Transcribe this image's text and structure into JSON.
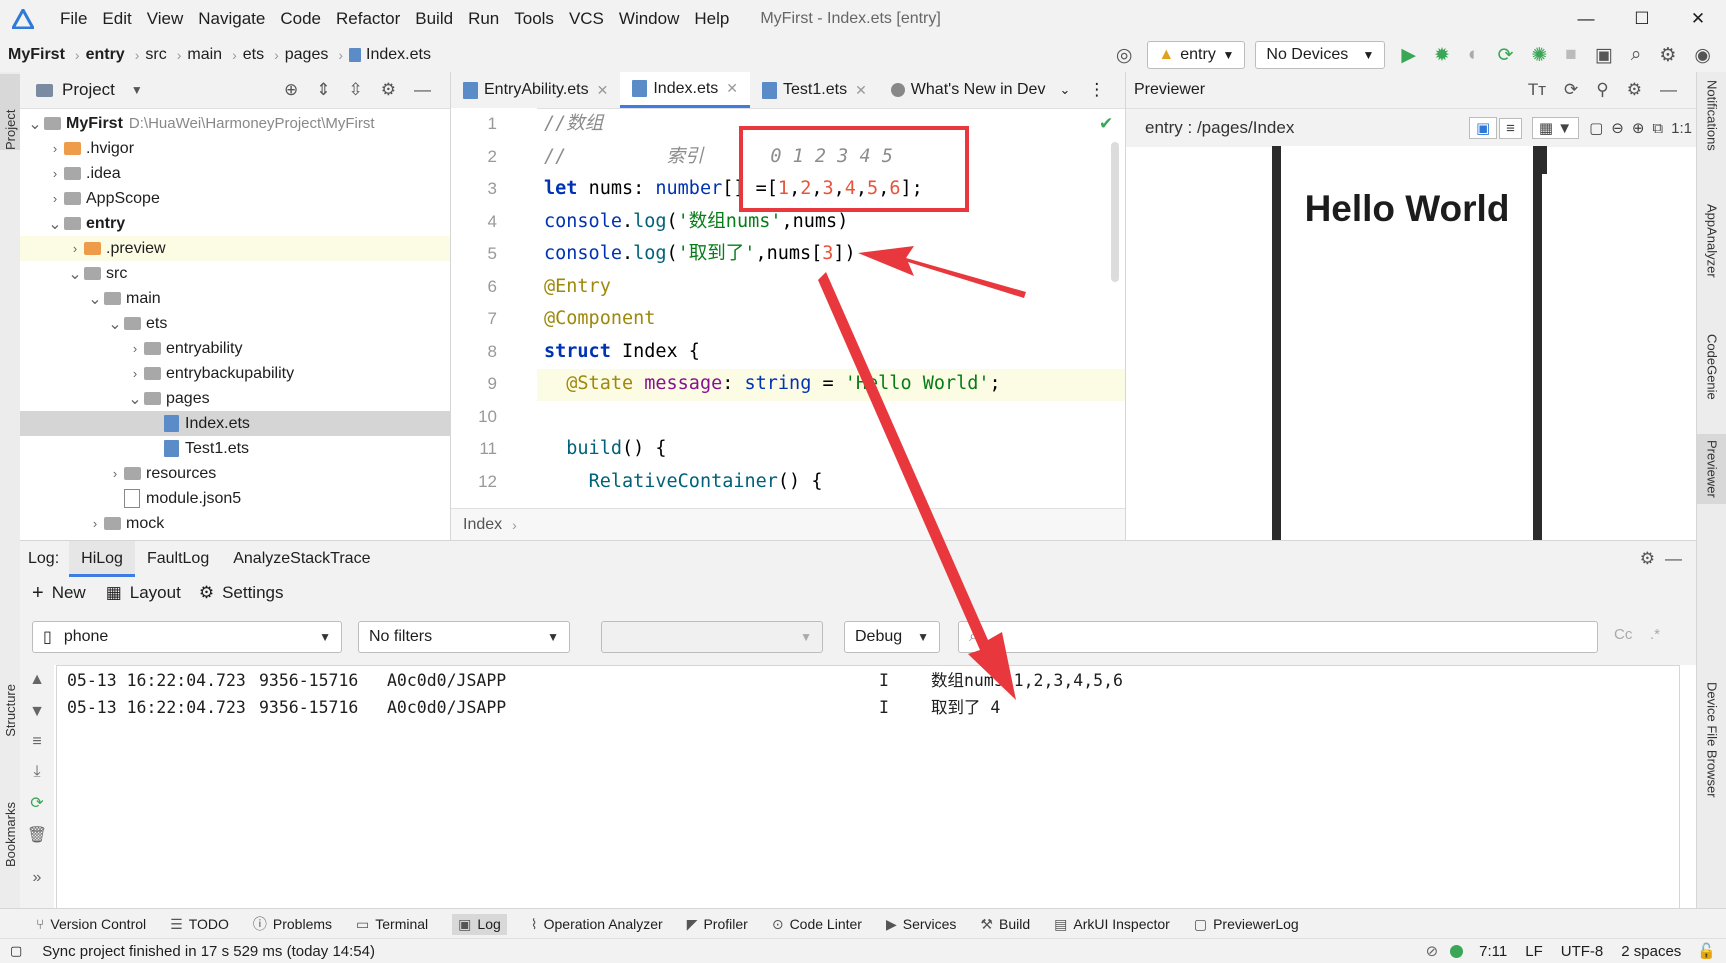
{
  "window": {
    "menu": [
      "File",
      "Edit",
      "View",
      "Navigate",
      "Code",
      "Refactor",
      "Build",
      "Run",
      "Tools",
      "VCS",
      "Window",
      "Help"
    ],
    "title": "MyFirst - Index.ets [entry]",
    "controls": {
      "minimize": "—",
      "maximize": "☐",
      "close": "✕"
    }
  },
  "nav": {
    "breadcrumbs": [
      "MyFirst",
      "entry",
      "src",
      "main",
      "ets",
      "pages",
      "Index.ets"
    ],
    "module_combo": "entry",
    "device_combo": "No Devices"
  },
  "left_rail": {
    "project": "Project",
    "structure": "Structure",
    "bookmarks": "Bookmarks"
  },
  "right_rail": {
    "items": [
      "Notifications",
      "AppAnalyzer",
      "CodeGenie",
      "Previewer",
      "Device File Browser"
    ]
  },
  "project": {
    "header": "Project",
    "tree": [
      {
        "label": "MyFirst",
        "path": "D:\\HuaWei\\HarmoneyProject\\MyFirst",
        "depth": 0,
        "expanded": true,
        "bold": true
      },
      {
        "label": ".hvigor",
        "depth": 1,
        "expanded": false,
        "color": "orange"
      },
      {
        "label": ".idea",
        "depth": 1,
        "expanded": false
      },
      {
        "label": "AppScope",
        "depth": 1,
        "expanded": false
      },
      {
        "label": "entry",
        "depth": 1,
        "expanded": true,
        "bold": true
      },
      {
        "label": ".preview",
        "depth": 2,
        "expanded": false,
        "color": "orange"
      },
      {
        "label": "src",
        "depth": 2,
        "expanded": true
      },
      {
        "label": "main",
        "depth": 3,
        "expanded": true
      },
      {
        "label": "ets",
        "depth": 4,
        "expanded": true
      },
      {
        "label": "entryability",
        "depth": 5,
        "expanded": false
      },
      {
        "label": "entrybackupability",
        "depth": 5,
        "expanded": false
      },
      {
        "label": "pages",
        "depth": 5,
        "expanded": true
      },
      {
        "label": "Index.ets",
        "depth": 6,
        "file": "ets",
        "selected": true
      },
      {
        "label": "Test1.ets",
        "depth": 6,
        "file": "ets"
      },
      {
        "label": "resources",
        "depth": 4,
        "expanded": false
      },
      {
        "label": "module.json5",
        "depth": 4,
        "file": "json"
      },
      {
        "label": "mock",
        "depth": 3,
        "expanded": false
      }
    ]
  },
  "editor": {
    "tabs": [
      {
        "label": "EntryAbility.ets",
        "active": false,
        "close": "✕"
      },
      {
        "label": "Index.ets",
        "active": true,
        "close": "✕"
      },
      {
        "label": "Test1.ets",
        "active": false,
        "close": "✕"
      },
      {
        "label": "What's New in Dev",
        "active": false,
        "close": ""
      }
    ],
    "line_numbers": [
      "1",
      "2",
      "3",
      "4",
      "5",
      "6",
      "7",
      "8",
      "9",
      "10",
      "11",
      "12"
    ],
    "lines": [
      [
        {
          "c": "cmt",
          "t": "//数组"
        }
      ],
      [
        {
          "c": "cmt",
          "t": "//         索引      0 1 2 3 4 5"
        }
      ],
      [
        {
          "c": "kw",
          "t": "let "
        },
        {
          "c": "typ",
          "t": "nums: "
        },
        {
          "c": "kw2",
          "t": "number"
        },
        {
          "c": "typ",
          "t": "[] ="
        },
        {
          "c": "typ",
          "t": "["
        },
        {
          "c": "num",
          "t": "1"
        },
        {
          "c": "typ",
          "t": ","
        },
        {
          "c": "num",
          "t": "2"
        },
        {
          "c": "typ",
          "t": ","
        },
        {
          "c": "num",
          "t": "3"
        },
        {
          "c": "typ",
          "t": ","
        },
        {
          "c": "num",
          "t": "4"
        },
        {
          "c": "typ",
          "t": ","
        },
        {
          "c": "num",
          "t": "5"
        },
        {
          "c": "typ",
          "t": ","
        },
        {
          "c": "num",
          "t": "6"
        },
        {
          "c": "typ",
          "t": "];"
        }
      ],
      [
        {
          "c": "kw2",
          "t": "console"
        },
        {
          "c": "typ",
          "t": "."
        },
        {
          "c": "fn",
          "t": "log"
        },
        {
          "c": "typ",
          "t": "("
        },
        {
          "c": "str",
          "t": "'数组nums'"
        },
        {
          "c": "typ",
          "t": ",nums)"
        }
      ],
      [
        {
          "c": "kw2",
          "t": "console"
        },
        {
          "c": "typ",
          "t": "."
        },
        {
          "c": "fn",
          "t": "log"
        },
        {
          "c": "typ",
          "t": "("
        },
        {
          "c": "str",
          "t": "'取到了'"
        },
        {
          "c": "typ",
          "t": ",nums["
        },
        {
          "c": "num",
          "t": "3"
        },
        {
          "c": "typ",
          "t": "])"
        }
      ],
      [
        {
          "c": "deco",
          "t": "@Entry"
        }
      ],
      [
        {
          "c": "deco",
          "t": "@Component"
        }
      ],
      [
        {
          "c": "kw",
          "t": "struct "
        },
        {
          "c": "typ",
          "t": "Index {"
        }
      ],
      [
        {
          "c": "deco",
          "t": "  @State "
        },
        {
          "c": "prop",
          "t": "message"
        },
        {
          "c": "typ",
          "t": ": "
        },
        {
          "c": "kw2",
          "t": "string "
        },
        {
          "c": "typ",
          "t": "= "
        },
        {
          "c": "str",
          "t": "'Hello World'"
        },
        {
          "c": "typ",
          "t": ";"
        }
      ],
      [
        {
          "c": "typ",
          "t": ""
        }
      ],
      [
        {
          "c": "typ",
          "t": "  "
        },
        {
          "c": "fn",
          "t": "build"
        },
        {
          "c": "typ",
          "t": "() {"
        }
      ],
      [
        {
          "c": "typ",
          "t": "    "
        },
        {
          "c": "fn",
          "t": "RelativeContainer"
        },
        {
          "c": "typ",
          "t": "() {"
        }
      ]
    ],
    "breadcrumb": "Index"
  },
  "previewer": {
    "header": "Previewer",
    "route": "entry : /pages/Index",
    "screen_text": "Hello World"
  },
  "log": {
    "label": "Log:",
    "tabs": [
      "HiLog",
      "FaultLog",
      "AnalyzeStackTrace"
    ],
    "toolbar": {
      "new": "New",
      "layout": "Layout",
      "settings": "Settings"
    },
    "device": "phone",
    "filter": "No filters",
    "level": "Debug",
    "search_placeholder": "",
    "case": "Cc",
    "regex": ".*",
    "entries": [
      {
        "time": "05-13 16:22:04.723",
        "pid": "9356-15716",
        "tag": "A0c0d0/JSAPP",
        "level": "I",
        "message": "数组nums 1,2,3,4,5,6"
      },
      {
        "time": "05-13 16:22:04.723",
        "pid": "9356-15716",
        "tag": "A0c0d0/JSAPP",
        "level": "I",
        "message": "取到了 4"
      }
    ]
  },
  "bottom_tabs": [
    "Version Control",
    "TODO",
    "Problems",
    "Terminal",
    "Log",
    "Operation Analyzer",
    "Profiler",
    "Code Linter",
    "Services",
    "Build",
    "ArkUI Inspector",
    "PreviewerLog"
  ],
  "status": {
    "message": "Sync project finished in 17 s 529 ms (today 14:54)",
    "position": "7:11",
    "line_sep": "LF",
    "encoding": "UTF-8",
    "indent": "2 spaces"
  },
  "colors": {
    "accent": "#3d7ce0",
    "annotation": "#e8383d"
  }
}
